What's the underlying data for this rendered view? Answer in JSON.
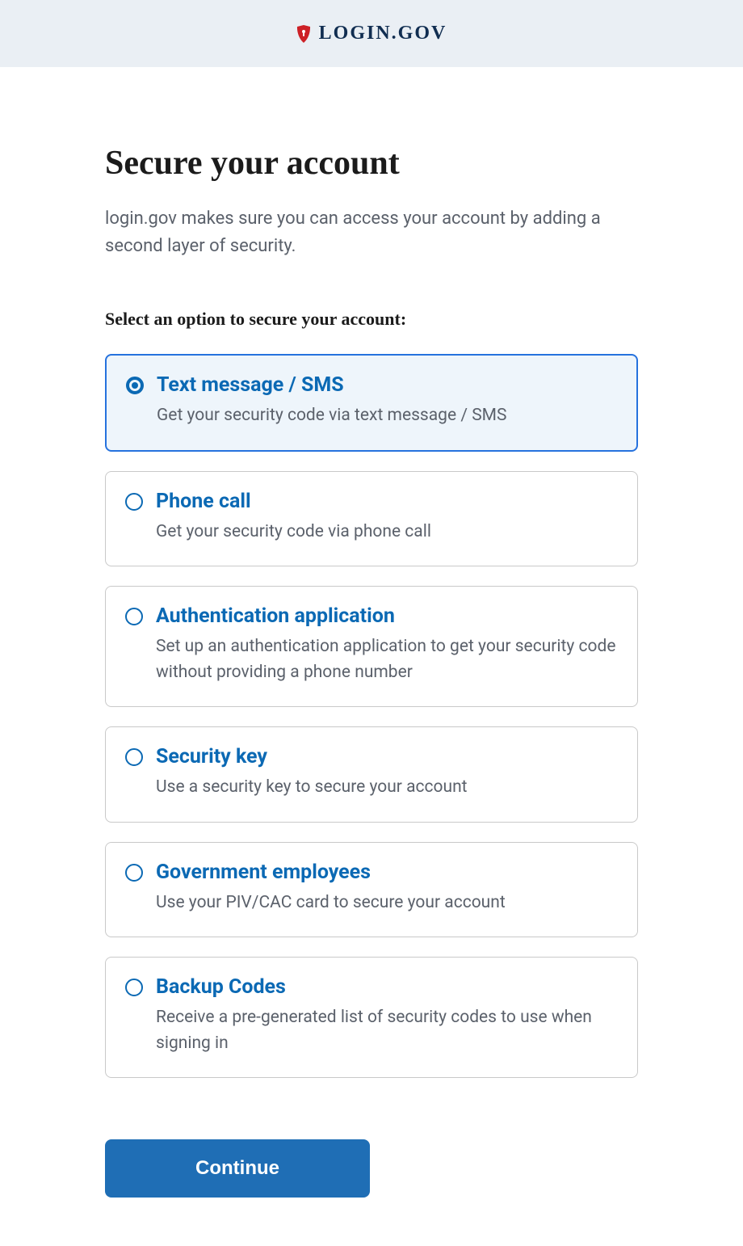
{
  "header": {
    "logo_text": "LOGIN.GOV"
  },
  "page": {
    "title": "Secure your account",
    "description": "login.gov makes sure you can access your account by adding a second layer of security.",
    "section_label": "Select an option to secure your account:"
  },
  "options": [
    {
      "title": "Text message / SMS",
      "description": "Get your security code via text message / SMS",
      "selected": true
    },
    {
      "title": "Phone call",
      "description": "Get your security code via phone call",
      "selected": false
    },
    {
      "title": "Authentication application",
      "description": "Set up an authentication application to get your security code without providing a phone number",
      "selected": false
    },
    {
      "title": "Security key",
      "description": "Use a security key to secure your account",
      "selected": false
    },
    {
      "title": "Government employees",
      "description": "Use your PIV/CAC card to secure your account",
      "selected": false
    },
    {
      "title": "Backup Codes",
      "description": "Receive a pre-generated list of security codes to use when signing in",
      "selected": false
    }
  ],
  "buttons": {
    "continue_label": "Continue"
  }
}
